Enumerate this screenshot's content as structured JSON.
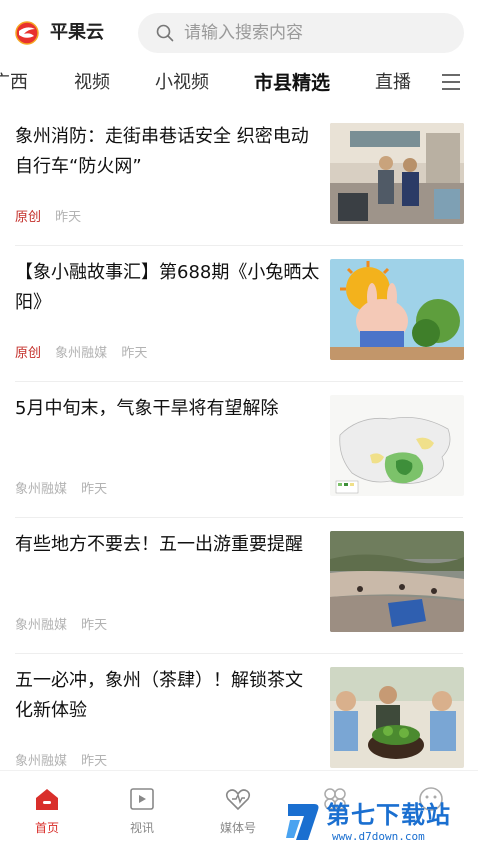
{
  "header": {
    "app_name": "平果云",
    "search_placeholder": "请输入搜索内容"
  },
  "tabs": [
    {
      "label": "广西"
    },
    {
      "label": "视频"
    },
    {
      "label": "小视频"
    },
    {
      "label": "市县精选",
      "active": true
    },
    {
      "label": "直播"
    }
  ],
  "feed": [
    {
      "title": "象州消防：走街串巷话安全 织密电动自行车“防火网”",
      "original": "原创",
      "source": "",
      "time": "昨天"
    },
    {
      "title": "【象小融故事汇】第688期《小兔晒太阳》",
      "original": "原创",
      "source": "象州融媒",
      "time": "昨天"
    },
    {
      "title": "5月中旬末，气象干旱将有望解除",
      "original": "",
      "source": "象州融媒",
      "time": "昨天"
    },
    {
      "title": "有些地方不要去！五一出游重要提醒",
      "original": "",
      "source": "象州融媒",
      "time": "昨天"
    },
    {
      "title": "五一必冲，象州（茶肆）！解锁茶文化新体验",
      "original": "",
      "source": "象州融媒",
      "time": "昨天"
    }
  ],
  "bottom_nav": [
    {
      "label": "首页",
      "icon": "home-icon",
      "active": true
    },
    {
      "label": "视讯",
      "icon": "video-icon"
    },
    {
      "label": "媒体号",
      "icon": "heart-icon"
    },
    {
      "label": "",
      "icon": "clover-icon"
    },
    {
      "label": "",
      "icon": "face-icon"
    }
  ],
  "watermark": {
    "text": "第七下载站",
    "url": "www.d7down.com"
  },
  "colors": {
    "accent": "#d92f2b",
    "watermark": "#1a6fd0"
  }
}
